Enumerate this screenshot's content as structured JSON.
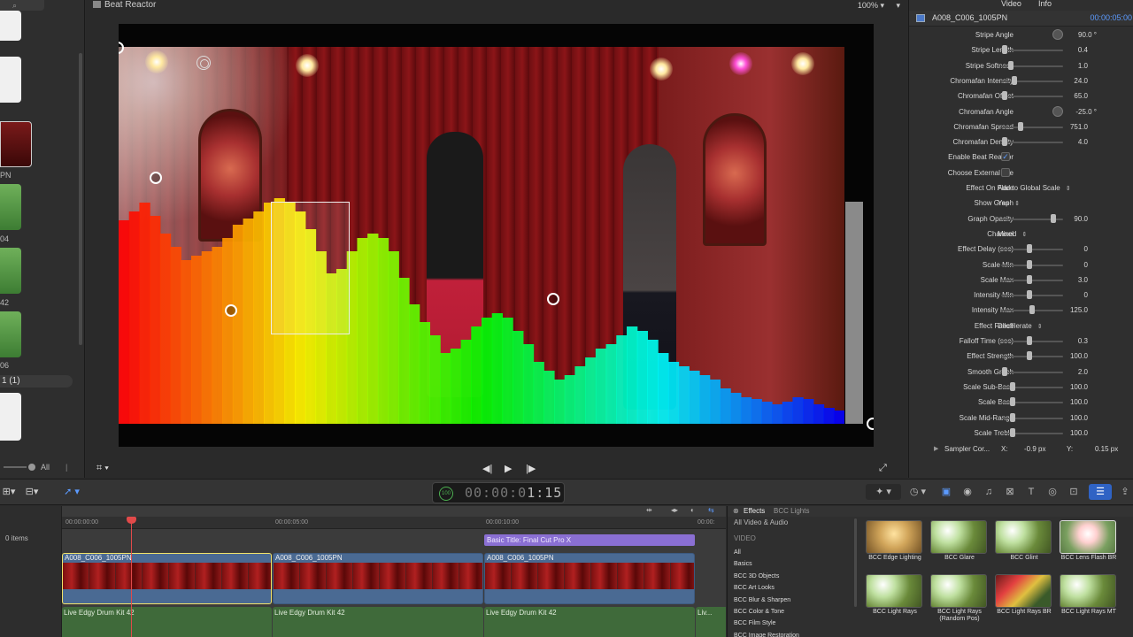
{
  "browser": {
    "labels": [
      "PN",
      "04",
      "42",
      "06"
    ],
    "count_label": "1  (1)",
    "filter": "All"
  },
  "viewer": {
    "title": "Beat Reactor",
    "zoom": "100%"
  },
  "inspector": {
    "tabs": [
      "Video",
      "Info"
    ],
    "clip_name": "A008_C006_1005PN",
    "clip_tc": "00:00:05:00",
    "params": [
      {
        "label": "Stripe Angle",
        "kind": "dial",
        "value": "90.0 °"
      },
      {
        "label": "Stripe Length",
        "kind": "slider",
        "pos": 0.02,
        "value": "0.4"
      },
      {
        "label": "Stripe Softness",
        "kind": "slider",
        "pos": 0.12,
        "value": "1.0"
      },
      {
        "label": "Chromafan Intensity",
        "kind": "slider",
        "pos": 0.18,
        "value": "24.0"
      },
      {
        "label": "Chromafan Offset",
        "kind": "slider",
        "pos": 0.02,
        "value": "65.0"
      },
      {
        "label": "Chromafan Angle",
        "kind": "dial",
        "value": "-25.0 °"
      },
      {
        "label": "Chromafan Spread",
        "kind": "slider",
        "pos": 0.3,
        "value": "751.0"
      },
      {
        "label": "Chromafan Density",
        "kind": "slider",
        "pos": 0.02,
        "value": "4.0"
      },
      {
        "label": "Enable Beat Reactor",
        "kind": "check",
        "checked": true,
        "value": ""
      },
      {
        "label": "Choose External File",
        "kind": "check",
        "checked": false,
        "value": ""
      },
      {
        "label": "Effect On Flare",
        "kind": "popup",
        "value": "Add to Global Scale"
      },
      {
        "label": "Show Graph",
        "kind": "popup",
        "value": "Yes"
      },
      {
        "label": "Graph Opacity",
        "kind": "slider",
        "pos": 0.88,
        "value": "90.0"
      },
      {
        "label": "Channel",
        "kind": "popup",
        "value": "Mixed"
      },
      {
        "label": "Effect Delay (sec)",
        "kind": "slider",
        "pos": 0.45,
        "value": "0"
      },
      {
        "label": "Scale Min",
        "kind": "slider",
        "pos": 0.45,
        "value": "0"
      },
      {
        "label": "Scale Max",
        "kind": "slider",
        "pos": 0.45,
        "value": "3.0"
      },
      {
        "label": "Intensity Min",
        "kind": "slider",
        "pos": 0.45,
        "value": "0"
      },
      {
        "label": "Intensity Max",
        "kind": "slider",
        "pos": 0.5,
        "value": "125.0"
      },
      {
        "label": "Effect Falloff",
        "kind": "popup",
        "value": "Decelerate"
      },
      {
        "label": "Falloff Time (sec)",
        "kind": "slider",
        "pos": 0.45,
        "value": "0.3"
      },
      {
        "label": "Effect Strength",
        "kind": "slider",
        "pos": 0.45,
        "value": "100.0"
      },
      {
        "label": "Smooth Graph",
        "kind": "slider",
        "pos": 0.02,
        "value": "2.0"
      },
      {
        "label": "Scale Sub-Bass",
        "kind": "slider",
        "pos": 0.15,
        "value": "100.0"
      },
      {
        "label": "Scale Bass",
        "kind": "slider",
        "pos": 0.15,
        "value": "100.0"
      },
      {
        "label": "Scale Mid-Range",
        "kind": "slider",
        "pos": 0.15,
        "value": "100.0"
      },
      {
        "label": "Scale Treble",
        "kind": "slider",
        "pos": 0.15,
        "value": "100.0"
      }
    ],
    "sampler": {
      "label": "Sampler Cor...",
      "x_label": "X:",
      "x": "-0.9 px",
      "y_label": "Y:",
      "y": "0.15 px"
    }
  },
  "toolbar": {
    "timecode_prefix": "00:00:0",
    "timecode_main": "1:15",
    "badge": "100"
  },
  "timeline": {
    "items_label": "0 items",
    "ruler": [
      "00:00:00:00",
      "00:00:05:00",
      "00:00:10:00",
      "00:00:"
    ],
    "title_clip": "Basic Title: Final Cut Pro X",
    "video_clips": [
      "A008_C006_1005PN",
      "A008_C006_1005PN",
      "A008_C006_1005PN"
    ],
    "audio_clips": [
      "Live Edgy Drum Kit 42",
      "Live Edgy Drum Kit 42",
      "Live Edgy Drum Kit 42",
      "Liv..."
    ]
  },
  "effects": {
    "title": "Effects",
    "subtitle": "BCC Lights",
    "all_label": "All Video & Audio",
    "section": "VIDEO",
    "categories": [
      "All",
      "Basics",
      "BCC 3D Objects",
      "BCC Art Looks",
      "BCC Blur & Sharpen",
      "BCC Color & Tone",
      "BCC Film Style",
      "BCC Image Restoration"
    ],
    "items": [
      "BCC Edge Lighting",
      "BCC Glare",
      "BCC Glint",
      "BCC Lens Flash BR",
      "BCC Light Rays",
      "BCC Light Rays (Random Pos)",
      "BCC Light Rays BR",
      "BCC Light Rays MT"
    ]
  }
}
